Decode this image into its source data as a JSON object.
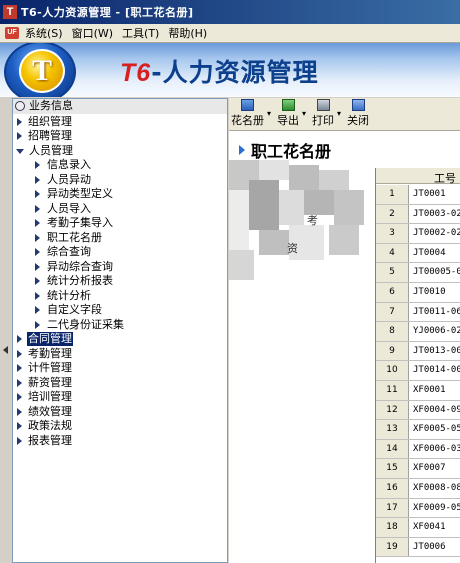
{
  "window": {
    "title": "T6-人力资源管理 - [职工花名册]"
  },
  "menu": [
    "系统(S)",
    "窗口(W)",
    "工具(T)",
    "帮助(H)"
  ],
  "banner": {
    "brand": "T6",
    "product": "-人力资源管理",
    "logo_letter": "T"
  },
  "tree": {
    "root": "业务信息",
    "items": [
      {
        "label": "组织管理",
        "level": 0,
        "expanded": false
      },
      {
        "label": "招聘管理",
        "level": 0,
        "expanded": false
      },
      {
        "label": "人员管理",
        "level": 0,
        "expanded": true
      },
      {
        "label": "信息录入",
        "level": 1
      },
      {
        "label": "人员异动",
        "level": 1
      },
      {
        "label": "异动类型定义",
        "level": 1
      },
      {
        "label": "人员导入",
        "level": 1
      },
      {
        "label": "考勤子集导入",
        "level": 1
      },
      {
        "label": "职工花名册",
        "level": 1
      },
      {
        "label": "综合查询",
        "level": 1
      },
      {
        "label": "异动综合查询",
        "level": 1
      },
      {
        "label": "统计分析报表",
        "level": 1
      },
      {
        "label": "统计分析",
        "level": 1
      },
      {
        "label": "自定义字段",
        "level": 1
      },
      {
        "label": "二代身份证采集",
        "level": 1
      },
      {
        "label": "合同管理",
        "level": 0,
        "selected": true
      },
      {
        "label": "考勤管理",
        "level": 0
      },
      {
        "label": "计件管理",
        "level": 0
      },
      {
        "label": "薪资管理",
        "level": 0
      },
      {
        "label": "培训管理",
        "level": 0
      },
      {
        "label": "绩效管理",
        "level": 0
      },
      {
        "label": "政策法规",
        "level": 0
      },
      {
        "label": "报表管理",
        "level": 0
      }
    ]
  },
  "toolbar": {
    "roster": "花名册",
    "export": "导出",
    "print": "打印",
    "close": "关闭"
  },
  "page": {
    "title": "职工花名册"
  },
  "blurred_fragments": [
    "考",
    "资"
  ],
  "grid": {
    "column_header": "工号",
    "rows": [
      {
        "num": "1",
        "code": "JT0001"
      },
      {
        "num": "2",
        "code": "JT0003-02"
      },
      {
        "num": "3",
        "code": "JT0002-02"
      },
      {
        "num": "4",
        "code": "JT0004"
      },
      {
        "num": "5",
        "code": "JT00005-0"
      },
      {
        "num": "6",
        "code": "JT0010"
      },
      {
        "num": "7",
        "code": "JT0011-06"
      },
      {
        "num": "8",
        "code": "YJ0006-02"
      },
      {
        "num": "9",
        "code": "JT0013-00"
      },
      {
        "num": "10",
        "code": "JT0014-00"
      },
      {
        "num": "11",
        "code": "XF0001"
      },
      {
        "num": "12",
        "code": "XF0004-09"
      },
      {
        "num": "13",
        "code": "XF0005-05"
      },
      {
        "num": "14",
        "code": "XF0006-03"
      },
      {
        "num": "15",
        "code": "XF0007"
      },
      {
        "num": "16",
        "code": "XF0008-08"
      },
      {
        "num": "17",
        "code": "XF0009-05"
      },
      {
        "num": "18",
        "code": "XF0041"
      },
      {
        "num": "19",
        "code": "JT0006"
      }
    ]
  },
  "colors": {
    "title_bar": "#0a246a",
    "brand_red": "#d81e1e",
    "brand_blue": "#0c3f8c",
    "selection": "#0a246a"
  },
  "icons": {
    "roster": "book-icon",
    "export": "export-icon",
    "print": "printer-icon",
    "close": "close-book-icon"
  }
}
